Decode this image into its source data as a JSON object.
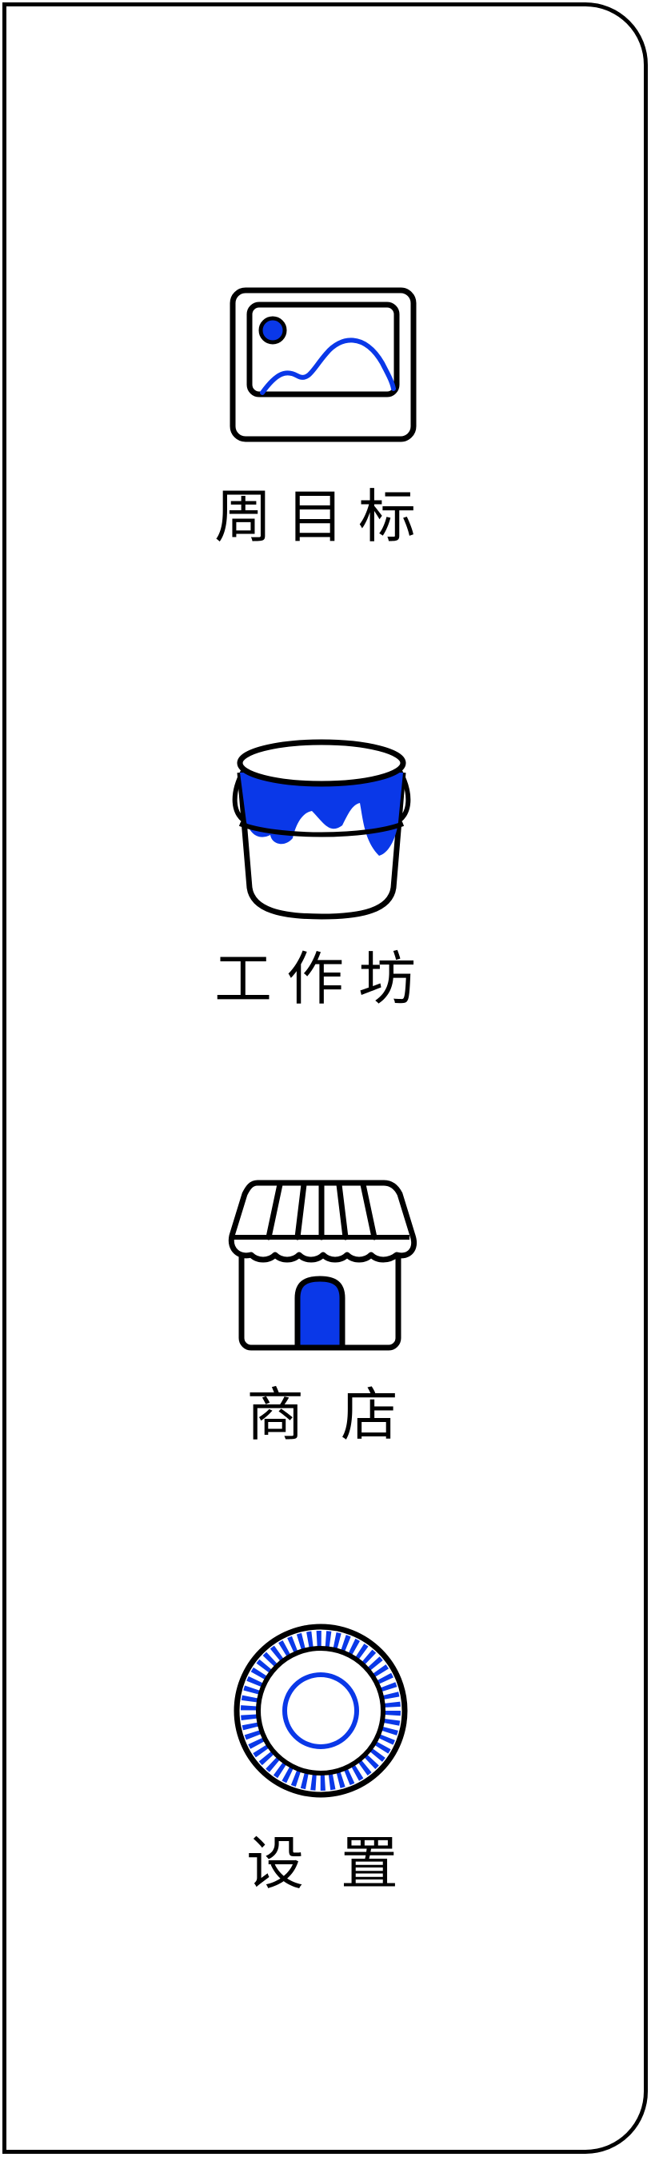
{
  "theme": {
    "accent": "#0a38e8",
    "outline": "#000000",
    "background": "#ffffff"
  },
  "sidebar": {
    "items": [
      {
        "id": "weekly-goals",
        "label": "周目标",
        "icon": "picture-icon"
      },
      {
        "id": "workshop",
        "label": "工作坊",
        "icon": "paint-bucket-icon"
      },
      {
        "id": "shop",
        "label": "商  店",
        "icon": "storefront-icon"
      },
      {
        "id": "settings",
        "label": "设  置",
        "icon": "settings-dial-icon"
      }
    ]
  }
}
